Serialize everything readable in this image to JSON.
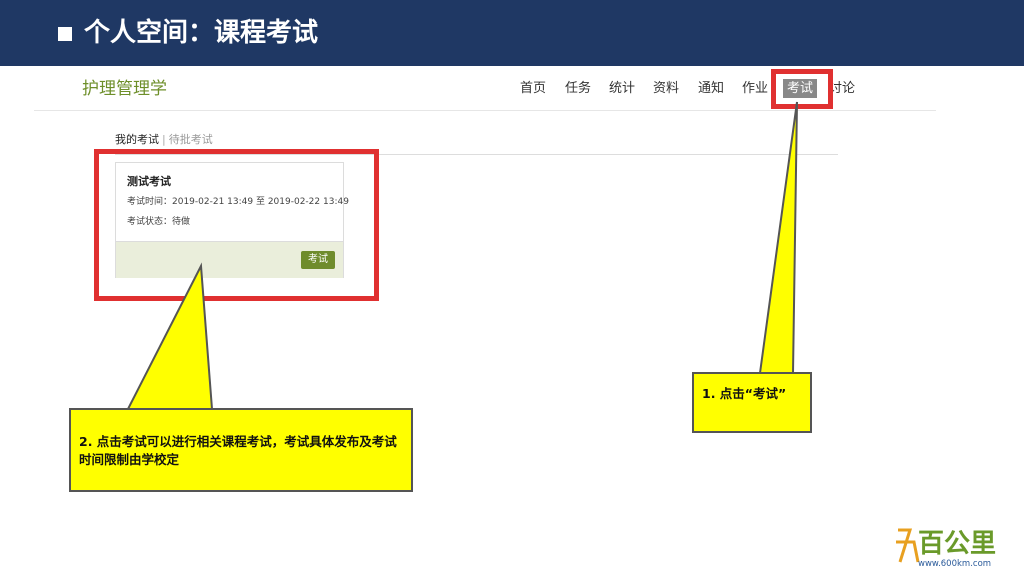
{
  "slide": {
    "title": "个人空间：课程考试"
  },
  "header": {
    "course_name": "护理管理学",
    "nav": [
      "首页",
      "任务",
      "统计",
      "资料",
      "通知",
      "作业",
      "考试",
      "讨论"
    ],
    "active_nav": "考试"
  },
  "subtabs": {
    "mine": "我的考试",
    "separator": "|",
    "pending": "待批考试"
  },
  "exam_card": {
    "title": "测试考试",
    "time": "考试时间：2019-02-21 13:49 至 2019-02-22 13:49",
    "status": "考试状态：待做",
    "button_label": "考试"
  },
  "annotations": {
    "step1": "1. 点击“考试”",
    "step2": "2. 点击考试可以进行相关课程考试，考试具体发布及考试时间限制由学校定"
  },
  "logo": {
    "text": "百公里",
    "url_text": "www.600km.com"
  },
  "colors": {
    "banner": "#1f3864",
    "course_green": "#6e8f2a",
    "highlight_red": "#e03030",
    "callout_yellow": "#ffff00",
    "exam_button": "#6f8c2c"
  }
}
